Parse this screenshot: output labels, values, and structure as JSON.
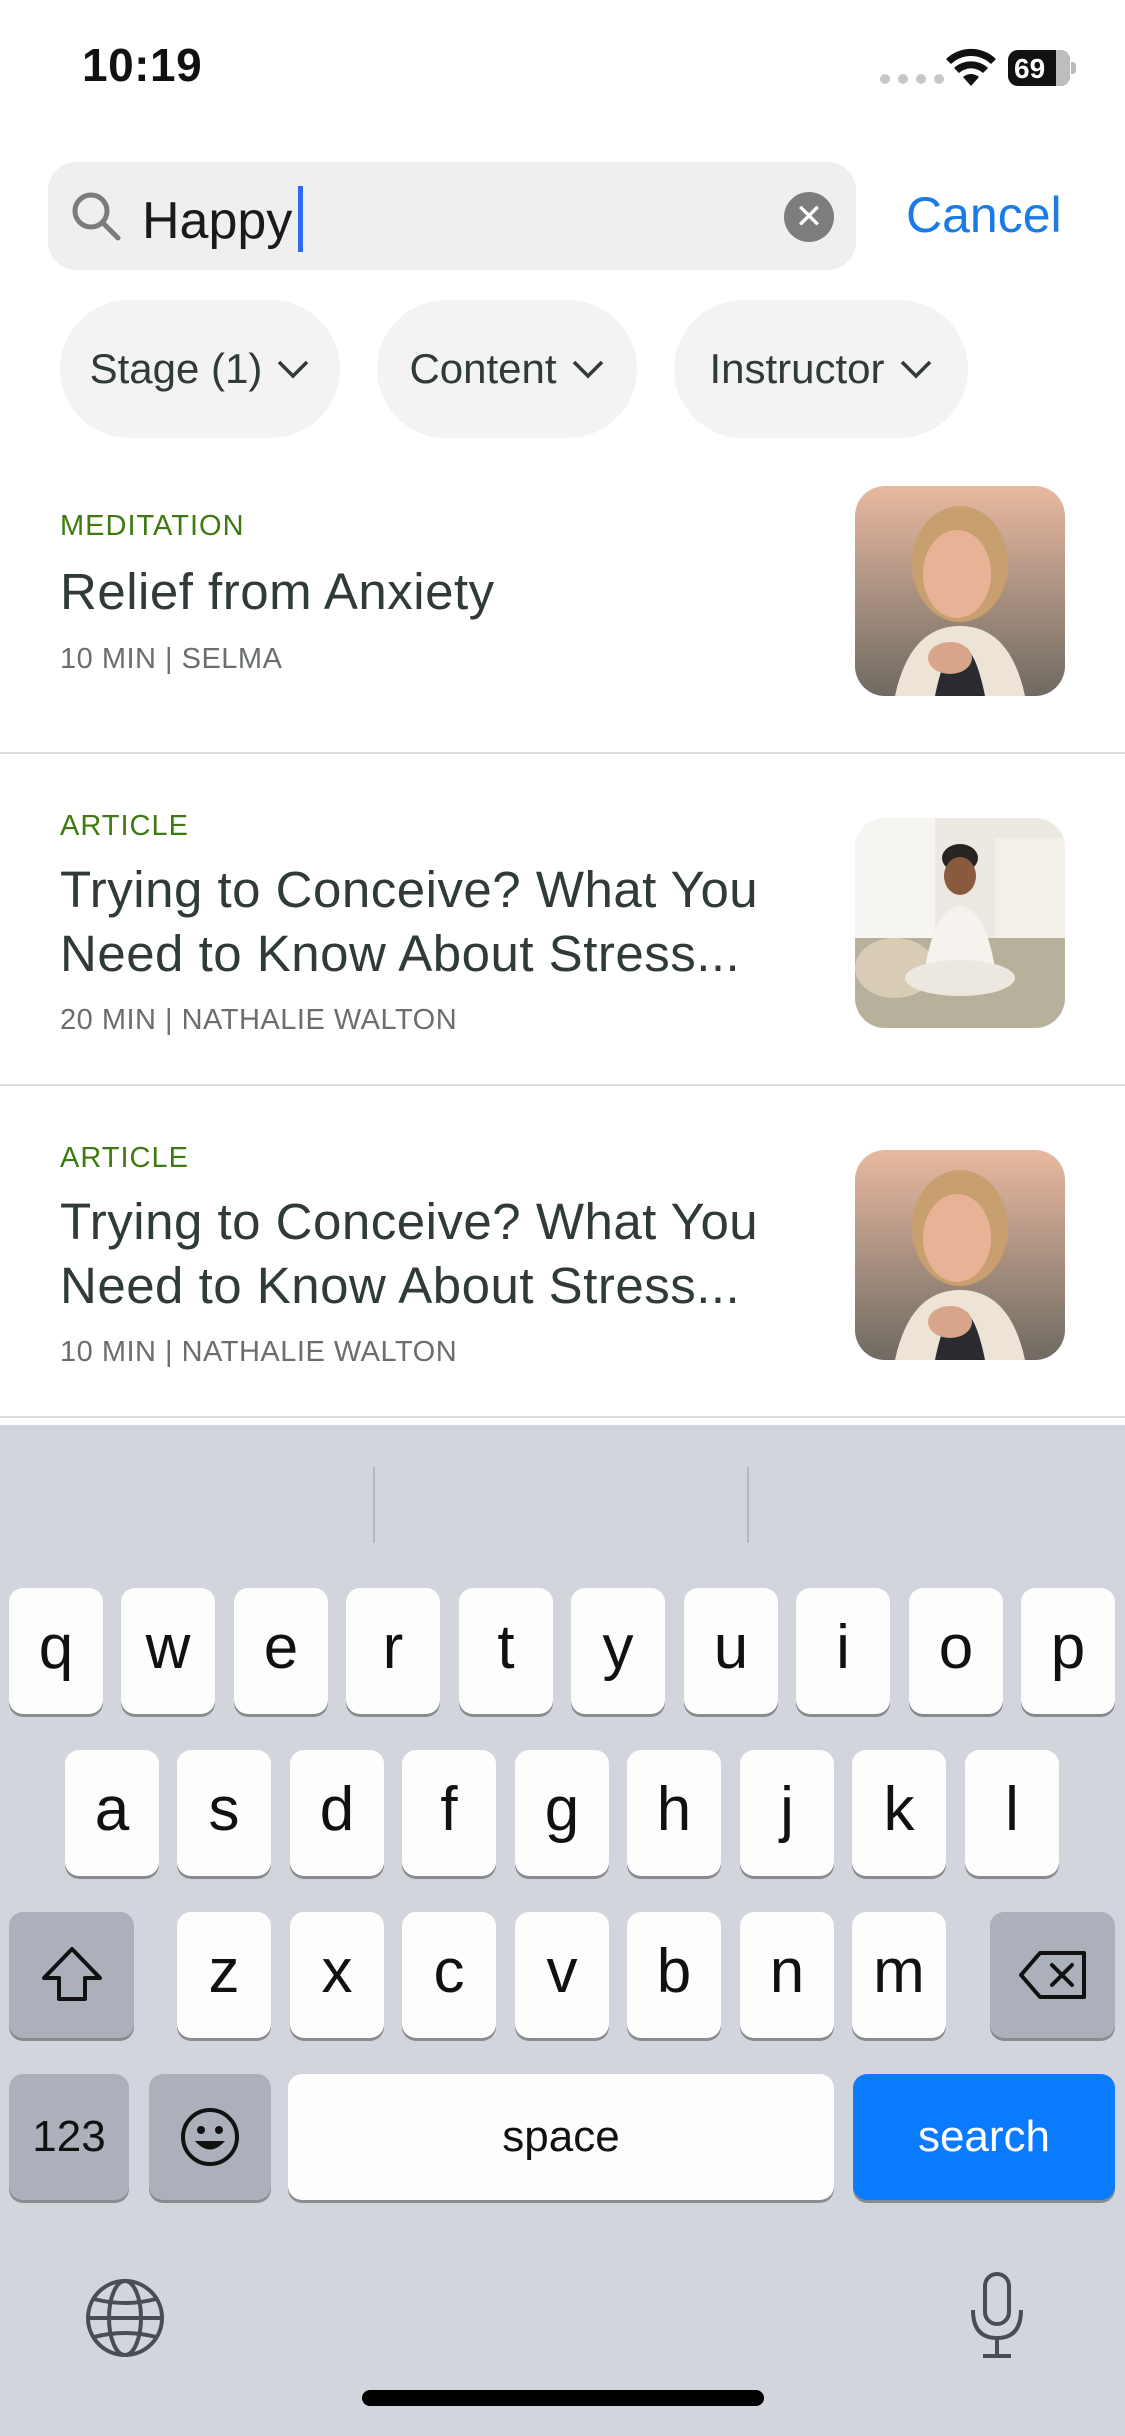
{
  "status": {
    "time": "10:19",
    "battery": "69"
  },
  "search": {
    "query": "Happy",
    "cancel_label": "Cancel"
  },
  "filters": [
    {
      "label": "Stage (1)"
    },
    {
      "label": "Content"
    },
    {
      "label": "Instructor"
    }
  ],
  "results": [
    {
      "tag": "MEDITATION",
      "title": "Relief from Anxiety",
      "meta": "10 MIN | SELMA"
    },
    {
      "tag": "ARTICLE",
      "title": "Trying to Conceive? What You Need to Know About Stress...",
      "meta": "20 MIN | NATHALIE WALTON"
    },
    {
      "tag": "ARTICLE",
      "title": "Trying to Conceive? What You Need to Know About Stress...",
      "meta": "10 MIN | NATHALIE WALTON"
    }
  ],
  "keyboard": {
    "row1": [
      "q",
      "w",
      "e",
      "r",
      "t",
      "y",
      "u",
      "i",
      "o",
      "p"
    ],
    "row2": [
      "a",
      "s",
      "d",
      "f",
      "g",
      "h",
      "j",
      "k",
      "l"
    ],
    "row3": [
      "z",
      "x",
      "c",
      "v",
      "b",
      "n",
      "m"
    ],
    "numbers_label": "123",
    "space_label": "space",
    "search_label": "search"
  },
  "colors": {
    "accent": "#1a7ae6",
    "tag_green": "#3f7a10",
    "keyboard_blue": "#0a7aff"
  }
}
